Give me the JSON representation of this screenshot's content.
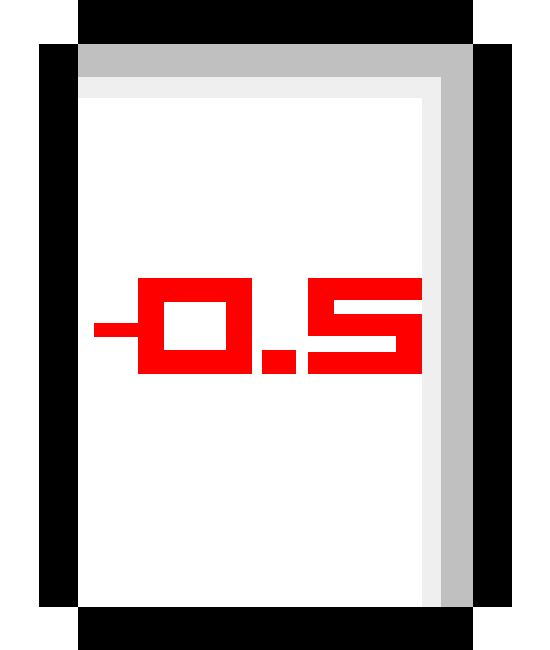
{
  "card": {
    "value_text": "-0.5",
    "colors": {
      "border": "#000000",
      "face": "#ffffff",
      "bevel_shadow": "#c0c0c0",
      "bevel_highlight": "#efefef",
      "value": "#ff0000"
    }
  }
}
